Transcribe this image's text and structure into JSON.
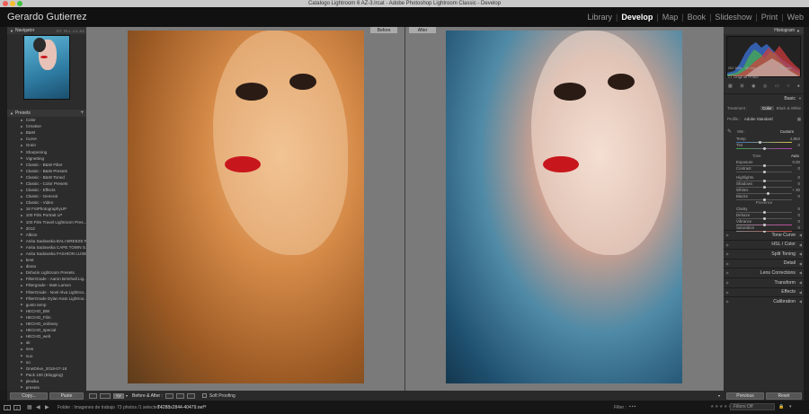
{
  "window": {
    "title": "Catalogo Lightroom 6 AZ-3.lrcat - Adobe Photoshop Lightroom Classic - Develop"
  },
  "identity_plate": "Gerardo Gutierrez",
  "modules": [
    "Library",
    "Develop",
    "Map",
    "Book",
    "Slideshow",
    "Print",
    "Web"
  ],
  "active_module": "Develop",
  "left_panel": {
    "navigator": {
      "label": "Navigator",
      "zoom_options": [
        "FIT",
        "FILL",
        "1:1",
        "8:1"
      ]
    },
    "presets": {
      "label": "Presets",
      "items": [
        "Color",
        "Creative",
        "B&W",
        "Curve",
        "Grain",
        "Sharpening",
        "Vignetting",
        "Classic - B&W Filter",
        "Classic - B&W Presets",
        "Classic - B&W Toned",
        "Classic - Color Presets",
        "Classic - Effects",
        "Classic - General",
        "Classic - Video",
        "18 FotPhotographyUP",
        "100 Film Portrait LP",
        "100 Film Travel Lightroom Pres...",
        "2012",
        "Albion",
        "Anita Sadowska BALI BREEZE P...",
        "Anita Sadowska CAPE TOWN S...",
        "Anita Sadowska FASHION LUXE...",
        "best",
        "diana",
        "Dshutin Lightroom Presets",
        "FilterGrade - Aaron Brimhall Lig...",
        "Filtergrade - Matt Larson",
        "FilterGrade - Noel Alva Lightroo...",
        "FilterGrade Dylan Kato Lightroo...",
        "gusto temp",
        "HECHO_BW",
        "HECHO_Film",
        "HECHO_ordinary",
        "HECHO_special",
        "HECHO_web",
        "ok",
        "new",
        "nuo",
        "no",
        "OneDrive_2018-07-18",
        "Pack 100 (Blogging)",
        "plexika",
        "presets"
      ]
    },
    "buttons": {
      "copy": "Copy...",
      "paste": "Paste"
    }
  },
  "center": {
    "before_label": "Before",
    "after_label": "After",
    "toolbar": {
      "before_after_label": "Before & After :",
      "soft_proofing": "Soft Proofing",
      "yy_label": "Y|Y"
    }
  },
  "right_panel": {
    "histogram": {
      "label": "Histogram",
      "iso": "ISO 1600",
      "focal": "85 mm",
      "aperture": "f / 2.8",
      "shutter": "1/250 sec",
      "original_photo": "Original Photo"
    },
    "basic": {
      "label": "Basic",
      "treatment_label": "Treatment :",
      "treatment_color": "Color",
      "treatment_bw": "Black & White",
      "profile_label": "Profile :",
      "profile_value": "Adobe Standard",
      "wb_label": "WB :",
      "wb_value": "Custom",
      "temp_label": "Temp",
      "temp_value": "2,864",
      "tint_label": "Tint",
      "tint_value": "0",
      "tone_label": "Tone",
      "auto_label": "Auto",
      "exposure_label": "Exposure",
      "exposure_value": "0.00",
      "contrast_label": "Contrast",
      "contrast_value": "0",
      "highlights_label": "Highlights",
      "highlights_value": "0",
      "shadows_label": "Shadows",
      "shadows_value": "0",
      "whites_label": "Whites",
      "whites_value": "+ 30",
      "blacks_label": "Blacks",
      "blacks_value": "0",
      "presence_label": "Presence",
      "clarity_label": "Clarity",
      "clarity_value": "0",
      "dehaze_label": "Dehaze",
      "dehaze_value": "0",
      "vibrance_label": "Vibrance",
      "vibrance_value": "0",
      "saturation_label": "Saturation",
      "saturation_value": "0"
    },
    "sections": [
      "Tone Curve",
      "HSL / Color",
      "Split Toning",
      "Detail",
      "Lens Corrections",
      "Transform",
      "Effects",
      "Calibration"
    ],
    "buttons": {
      "previous": "Previous",
      "reset": "Reset"
    }
  },
  "filmstrip": {
    "page_a": "1",
    "page_b": "2",
    "folder_label": "Folder : Imagenes de trabajo",
    "count": "73 photos /1 selected /",
    "filename": "T4288x2844-40479.nef",
    "filter_label": "Filter :",
    "filters_off": "Filters Off"
  }
}
